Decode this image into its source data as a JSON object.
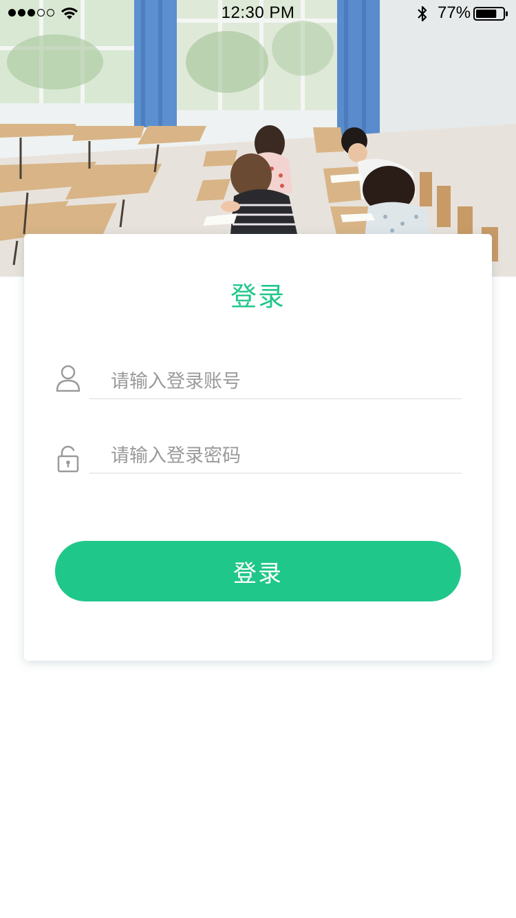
{
  "status_bar": {
    "time": "12:30 PM",
    "battery_percent": "77%",
    "battery_level": 0.77,
    "signal_bars_filled": 3,
    "signal_bars_total": 5
  },
  "hero": {
    "image": "classroom-photo"
  },
  "login": {
    "title": "登录",
    "account_placeholder": "请输入登录账号",
    "account_value": "",
    "password_placeholder": "请输入登录密码",
    "password_value": "",
    "submit_label": "登录"
  },
  "icons": {
    "account": "user-icon",
    "password": "unlock-icon"
  },
  "colors": {
    "accent": "#20c78a",
    "placeholder": "#9a9a9a",
    "divider": "#dcdcdc",
    "background": "#ffffff"
  }
}
